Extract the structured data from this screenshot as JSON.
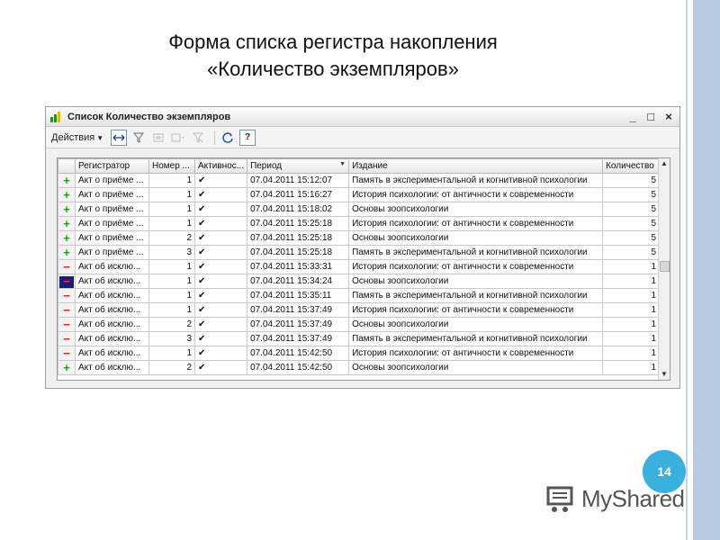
{
  "slide": {
    "title_line1": "Форма списка регистра накопления",
    "title_line2": "«Количество экземпляров»",
    "page_number": "14",
    "logo_text": "MyShared"
  },
  "window": {
    "title": "Список Количество экземпляров",
    "minimize_label": "_",
    "maximize_label": "□",
    "close_label": "×"
  },
  "toolbar": {
    "actions_label": "Действия",
    "help_label": "?"
  },
  "table": {
    "columns": {
      "registrar": "Регистратор",
      "number": "Номер ...",
      "active": "Активнос...",
      "period": "Период",
      "edition": "Издание",
      "quantity": "Количество"
    },
    "rows": [
      {
        "type": "plus",
        "registrar": "Акт о приёме ...",
        "number": "1",
        "active": "✔",
        "period": "07.04.2011 15:12:07",
        "edition": "Память в экспериментальной и когнитивной психологии",
        "quantity": "5"
      },
      {
        "type": "plus",
        "registrar": "Акт о приёме ...",
        "number": "1",
        "active": "✔",
        "period": "07.04.2011 15:16:27",
        "edition": "История психологии: от античности к современности",
        "quantity": "5"
      },
      {
        "type": "plus",
        "registrar": "Акт о приёме ...",
        "number": "1",
        "active": "✔",
        "period": "07.04.2011 15:18:02",
        "edition": "Основы зоопсихологии",
        "quantity": "5"
      },
      {
        "type": "plus",
        "registrar": "Акт о приёме ...",
        "number": "1",
        "active": "✔",
        "period": "07.04.2011 15:25:18",
        "edition": "История психологии: от античности к современности",
        "quantity": "5"
      },
      {
        "type": "plus",
        "registrar": "Акт о приёме ...",
        "number": "2",
        "active": "✔",
        "period": "07.04.2011 15:25:18",
        "edition": "Основы зоопсихологии",
        "quantity": "5"
      },
      {
        "type": "plus",
        "registrar": "Акт о приёме ...",
        "number": "3",
        "active": "✔",
        "period": "07.04.2011 15:25:18",
        "edition": "Память в экспериментальной и когнитивной психологии",
        "quantity": "5"
      },
      {
        "type": "minus",
        "registrar": "Акт об исклю...",
        "number": "1",
        "active": "✔",
        "period": "07.04.2011 15:33:31",
        "edition": "История психологии: от античности к современности",
        "quantity": "1"
      },
      {
        "type": "minus-selected",
        "registrar": "Акт об исклю...",
        "number": "1",
        "active": "✔",
        "period": "07.04.2011 15:34:24",
        "edition": "Основы зоопсихологии",
        "quantity": "1"
      },
      {
        "type": "minus",
        "registrar": "Акт об исклю...",
        "number": "1",
        "active": "✔",
        "period": "07.04.2011 15:35:11",
        "edition": "Память в экспериментальной и когнитивной психологии",
        "quantity": "1"
      },
      {
        "type": "minus",
        "registrar": "Акт об исклю...",
        "number": "1",
        "active": "✔",
        "period": "07.04.2011 15:37:49",
        "edition": "История психологии: от античности к современности",
        "quantity": "1"
      },
      {
        "type": "minus",
        "registrar": "Акт об исклю...",
        "number": "2",
        "active": "✔",
        "period": "07.04.2011 15:37:49",
        "edition": "Основы зоопсихологии",
        "quantity": "1"
      },
      {
        "type": "minus",
        "registrar": "Акт об исклю...",
        "number": "3",
        "active": "✔",
        "period": "07.04.2011 15:37:49",
        "edition": "Память в экспериментальной и когнитивной психологии",
        "quantity": "1"
      },
      {
        "type": "minus",
        "registrar": "Акт об исклю...",
        "number": "1",
        "active": "✔",
        "period": "07.04.2011 15:42:50",
        "edition": "История психологии: от античности к современности",
        "quantity": "1"
      },
      {
        "type": "plus",
        "registrar": "Акт об исклю...",
        "number": "2",
        "active": "✔",
        "period": "07.04.2011 15:42:50",
        "edition": "Основы зоопсихологии",
        "quantity": "1"
      }
    ]
  },
  "icons": {
    "plus": "+",
    "minus": "−"
  },
  "colors": {
    "plus": "#1e9a1e",
    "minus": "#d02020",
    "badge": "#3ab0dc",
    "selected_row_marker": "#1c1c7a"
  }
}
